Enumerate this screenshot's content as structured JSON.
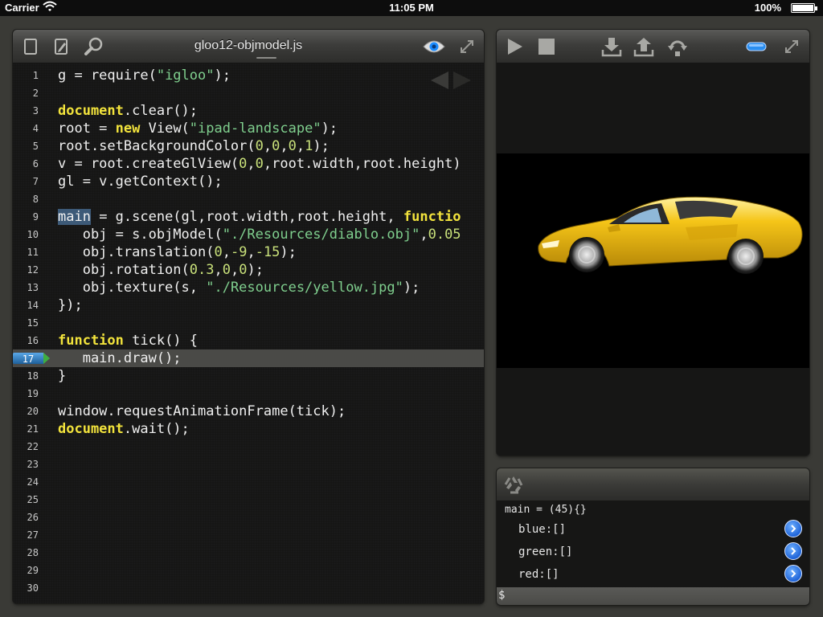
{
  "status_bar": {
    "carrier": "Carrier",
    "time": "11:05 PM",
    "battery": "100%"
  },
  "editor": {
    "filename": "gloo12-objmodel.js",
    "breakpoint_line": "17",
    "line_numbers": [
      "1",
      "2",
      "3",
      "4",
      "5",
      "6",
      "7",
      "8",
      "9",
      "10",
      "11",
      "12",
      "13",
      "14",
      "15",
      "16",
      "17",
      "18",
      "19",
      "20",
      "21",
      "22",
      "23",
      "24",
      "25",
      "26",
      "27",
      "28",
      "29",
      "30"
    ],
    "code": {
      "l1": {
        "a": "g = require(",
        "b": "\"igloo\"",
        "c": ");"
      },
      "l3": {
        "a": "document",
        "b": ".clear();"
      },
      "l4": {
        "a": "root = ",
        "b": "new",
        "c": " View(",
        "d": "\"ipad-landscape\"",
        "e": ");"
      },
      "l5": {
        "a": "root.setBackgroundColor(",
        "b": "0",
        "c": ",",
        "d": "0",
        "e": ",",
        "f": "0",
        "g": ",",
        "h": "1",
        "i": ");"
      },
      "l6": {
        "a": "v = root.createGlView(",
        "b": "0",
        "c": ",",
        "d": "0",
        "e": ",root.width,root.height)"
      },
      "l7": {
        "a": "gl = v.getContext();"
      },
      "l9": {
        "a": "main",
        "b": " = g.scene(gl,root.width,root.height, ",
        "c": "functio"
      },
      "l10": {
        "a": "   obj = s.objModel(",
        "b": "\"./Resources/diablo.obj\"",
        "c": ",",
        "d": "0.05"
      },
      "l11": {
        "a": "   obj.translation(",
        "b": "0",
        "c": ",",
        "d": "-9",
        "e": ",",
        "f": "-15",
        "g": ");"
      },
      "l12": {
        "a": "   obj.rotation(",
        "b": "0.3",
        "c": ",",
        "d": "0",
        "e": ",",
        "f": "0",
        "g": ");"
      },
      "l13": {
        "a": "   obj.texture(s, ",
        "b": "\"./Resources/yellow.jpg\"",
        "c": ");"
      },
      "l14": {
        "a": "});"
      },
      "l16": {
        "a": "function",
        "b": " tick() {"
      },
      "l17": {
        "a": "   main.draw();"
      },
      "l18": {
        "a": "}"
      },
      "l20": {
        "a": "window.requestAnimationFrame(tick);"
      },
      "l21": {
        "a": "document",
        "b": ".wait();"
      }
    }
  },
  "console": {
    "root_label": "main = (45){}",
    "properties": [
      {
        "label": "blue:[]"
      },
      {
        "label": "green:[]"
      },
      {
        "label": "red:[]"
      }
    ],
    "prompt": "$"
  },
  "colors": {
    "keyword": "#f2e33c",
    "string": "#7fcf8e",
    "number": "#c8e07a",
    "selection": "#3d5a78",
    "accent": "#2a8ef0",
    "car": "#f5c518"
  },
  "icons": {
    "editor_toolbar": [
      "new-file-icon",
      "edit-file-icon",
      "search-icon",
      "eye-icon",
      "expand-icon"
    ],
    "preview_toolbar": [
      "play-icon",
      "stop-icon",
      "download-icon",
      "upload-icon",
      "reload-icon",
      "slider-icon",
      "expand-icon"
    ],
    "console_toolbar": [
      "recycle-icon"
    ]
  }
}
